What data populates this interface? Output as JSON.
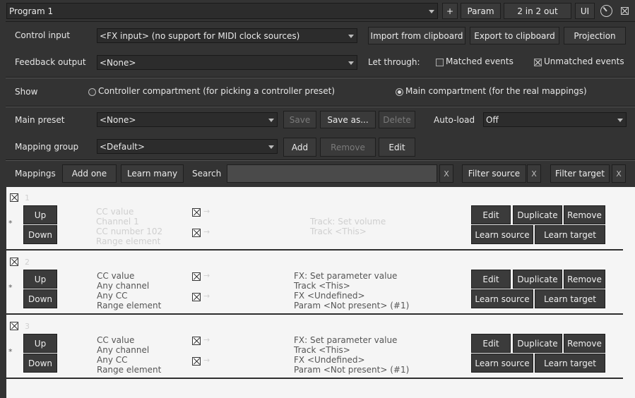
{
  "header": {
    "program_select": "Program 1",
    "plus_label": "+",
    "param_label": "Param",
    "io_label": "2 in 2 out",
    "ui_label": "UI",
    "knob_icon": "knob-icon",
    "close_icon": "close-icon"
  },
  "control": {
    "control_input_label": "Control input",
    "control_input_value": "<FX input> (no support for MIDI clock sources)",
    "import_label": "Import from clipboard",
    "export_label": "Export to clipboard",
    "projection_label": "Projection",
    "feedback_output_label": "Feedback output",
    "feedback_output_value": "<None>",
    "let_through_label": "Let through:",
    "matched_events_label": "Matched events",
    "matched_events_checked": false,
    "unmatched_events_label": "Unmatched events",
    "unmatched_events_checked": true
  },
  "show": {
    "label": "Show",
    "controller_label": "Controller compartment (for picking a controller preset)",
    "main_label": "Main compartment (for the real mappings)",
    "selected": "main"
  },
  "preset": {
    "main_preset_label": "Main preset",
    "main_preset_value": "<None>",
    "save_label": "Save",
    "save_as_label": "Save as...",
    "delete_label": "Delete",
    "auto_load_label": "Auto-load",
    "auto_load_value": "Off",
    "mapping_group_label": "Mapping group",
    "mapping_group_value": "<Default>",
    "add_label": "Add",
    "remove_label": "Remove",
    "edit_label": "Edit"
  },
  "mappings_bar": {
    "mappings_label": "Mappings",
    "add_one_label": "Add one",
    "learn_many_label": "Learn many",
    "search_label": "Search",
    "search_value": "",
    "clear_x": "X",
    "filter_source_label": "Filter source",
    "filter_target_label": "Filter target"
  },
  "row_buttons": {
    "up": "Up",
    "down": "Down",
    "edit": "Edit",
    "duplicate": "Duplicate",
    "remove": "Remove",
    "learn_source": "Learn source",
    "learn_target": "Learn target",
    "star": "*",
    "arrow": "→"
  },
  "mappings": [
    {
      "number": "1",
      "enabled": true,
      "faded": true,
      "source": [
        "CC value",
        "Channel 1",
        "CC number 102",
        "Range element"
      ],
      "control_enabled": true,
      "feedback_enabled": true,
      "target": [
        "Track: Set volume",
        "Track <This>"
      ]
    },
    {
      "number": "2",
      "enabled": true,
      "faded": false,
      "source": [
        "CC value",
        "Any channel",
        "Any CC",
        "Range element"
      ],
      "control_enabled": true,
      "feedback_enabled": true,
      "target": [
        "FX: Set parameter value",
        "Track <This>",
        "FX <Undefined>",
        "Param <Not present> (#1)"
      ]
    },
    {
      "number": "3",
      "enabled": true,
      "faded": false,
      "source": [
        "CC value",
        "Any channel",
        "Any CC",
        "Range element"
      ],
      "control_enabled": true,
      "feedback_enabled": true,
      "target": [
        "FX: Set parameter value",
        "Track <This>",
        "FX <Undefined>",
        "Param <Not present> (#1)"
      ]
    }
  ]
}
